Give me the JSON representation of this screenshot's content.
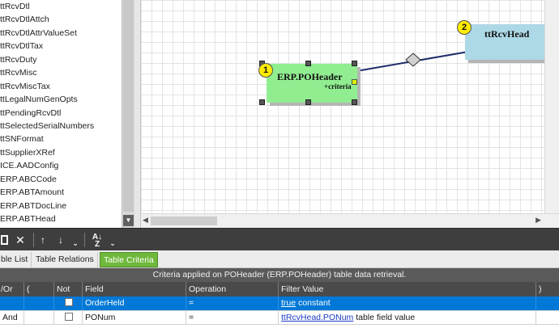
{
  "table_list": {
    "items": [
      "ttRcvDtl",
      "ttRcvDtlAttch",
      "ttRcvDtlAttrValueSet",
      "ttRcvDtlTax",
      "ttRcvDuty",
      "ttRcvMisc",
      "ttRcvMiscTax",
      "ttLegalNumGenOpts",
      "ttPendingRcvDtl",
      "ttSelectedSerialNumbers",
      "ttSNFormat",
      "ttSupplierXRef",
      "ICE.AADConfig",
      "ERP.ABCCode",
      "ERP.ABTAmount",
      "ERP.ABTDocLine",
      "ERP.ABTHead"
    ]
  },
  "canvas": {
    "entities": [
      {
        "badge": "1",
        "title": "ERP.POHeader",
        "subtitle": "+criteria"
      },
      {
        "badge": "2",
        "title": "ttRcvHead",
        "subtitle": ""
      }
    ],
    "colors": {
      "poheader": "#90ee90",
      "rcvhead": "#add8e6",
      "badge": "#ffeb00",
      "relation_line": "#1f2b6b"
    }
  },
  "toolbar": {
    "icons": [
      "delete-icon",
      "close-icon",
      "move-up-icon",
      "move-down-icon",
      "sort-az-icon"
    ]
  },
  "tabs": [
    {
      "label": "Table List",
      "shown": "ble List",
      "active": false
    },
    {
      "label": "Table Relations",
      "active": false
    },
    {
      "label": "Table Criteria",
      "active": true
    }
  ],
  "criteria": {
    "caption": "Criteria applied on POHeader (ERP.POHeader)  table data retrieval.",
    "columns": [
      "/Or",
      "(",
      "Not",
      "Field",
      "Operation",
      "Filter Value",
      ")"
    ],
    "rows": [
      {
        "andor": "",
        "paren_open": "",
        "not": false,
        "field": "OrderHeld",
        "operation": "=",
        "value_link": "true",
        "value_text": "constant",
        "paren_close": "",
        "selected": true
      },
      {
        "andor": "And",
        "paren_open": "",
        "not": false,
        "field": "PONum",
        "operation": "=",
        "value_link": "ttRcvHead.PONum",
        "value_text": "table field value",
        "paren_close": "",
        "selected": false
      }
    ]
  }
}
